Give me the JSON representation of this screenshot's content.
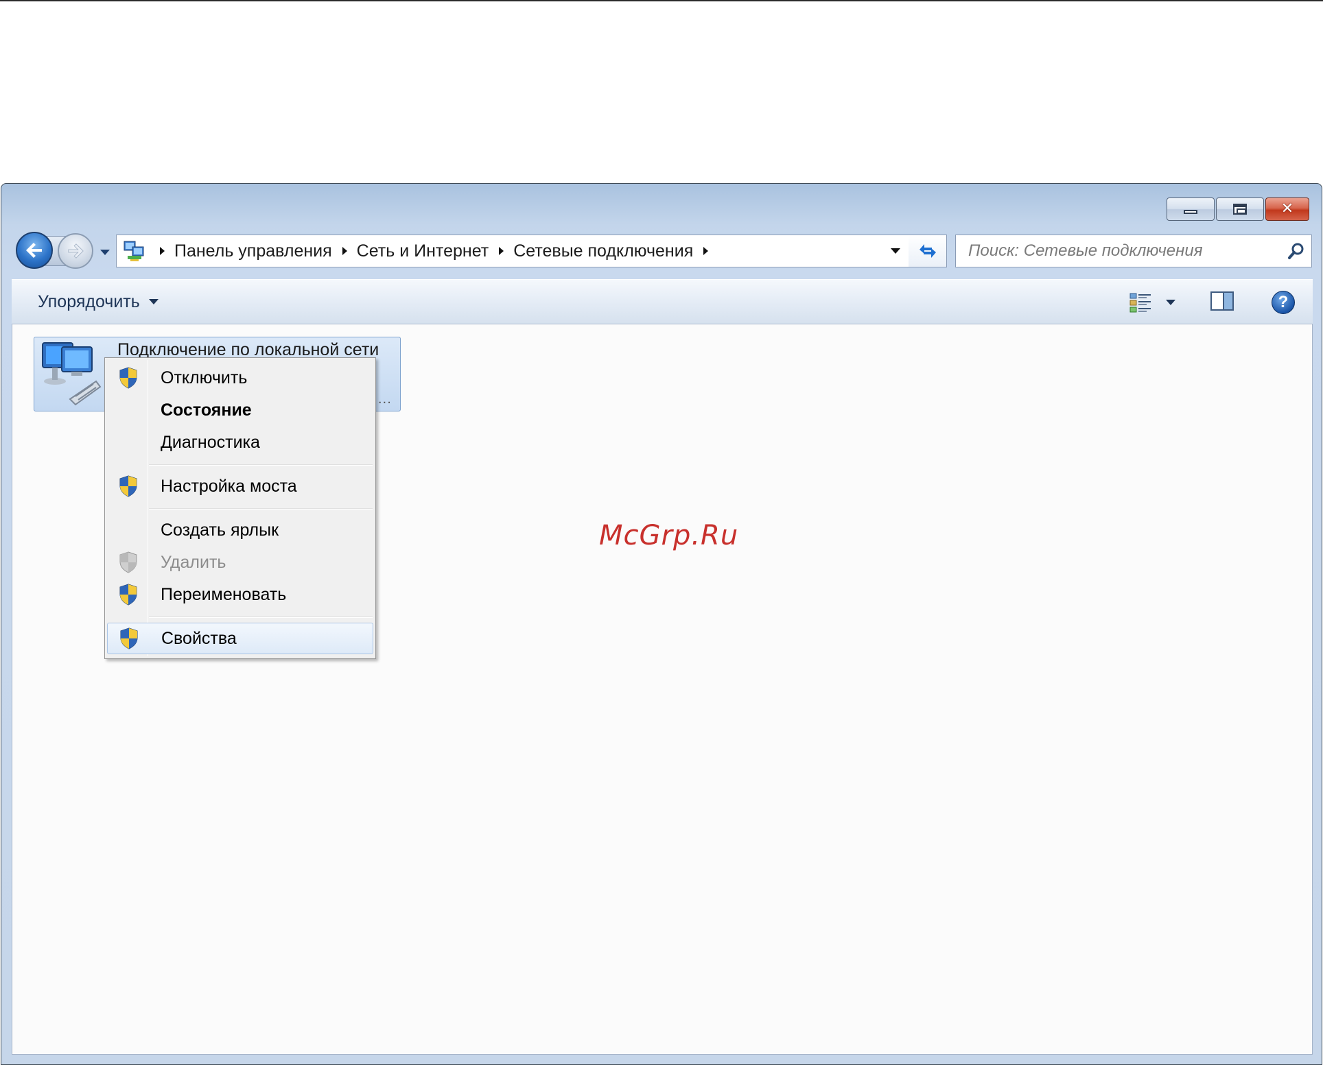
{
  "window": {
    "buttons": {
      "minimize_icon": "minimize-icon",
      "maximize_icon": "maximize-icon",
      "close_glyph": "✕"
    }
  },
  "address_bar": {
    "breadcrumbs": [
      {
        "label": "Панель управления"
      },
      {
        "label": "Сеть и Интернет"
      },
      {
        "label": "Сетевые подключения"
      }
    ]
  },
  "search": {
    "placeholder": "Поиск: Сетевые подключения"
  },
  "command_bar": {
    "organize_label": "Упорядочить",
    "help_glyph": "?"
  },
  "content": {
    "connection": {
      "name": "Подключение по локальной сети",
      "overflow": "..."
    }
  },
  "watermark": "McGrp.Ru",
  "context_menu": {
    "items": [
      {
        "label": "Отключить",
        "shield": true,
        "disabled": false,
        "bold": false
      },
      {
        "label": "Состояние",
        "shield": false,
        "disabled": false,
        "bold": true
      },
      {
        "label": "Диагностика",
        "shield": false,
        "disabled": false,
        "bold": false
      },
      {
        "label": "Настройка моста",
        "shield": true,
        "disabled": false,
        "bold": false
      },
      {
        "label": "Создать ярлык",
        "shield": false,
        "disabled": false,
        "bold": false
      },
      {
        "label": "Удалить",
        "shield": true,
        "disabled": true,
        "bold": false
      },
      {
        "label": "Переименовать",
        "shield": true,
        "disabled": false,
        "bold": false
      },
      {
        "label": "Свойства",
        "shield": true,
        "disabled": false,
        "bold": false,
        "hovered": true
      }
    ]
  },
  "colors": {
    "watermark": "#c8302c",
    "close_button": "#c1381c",
    "selection": "#c3d8f1"
  }
}
